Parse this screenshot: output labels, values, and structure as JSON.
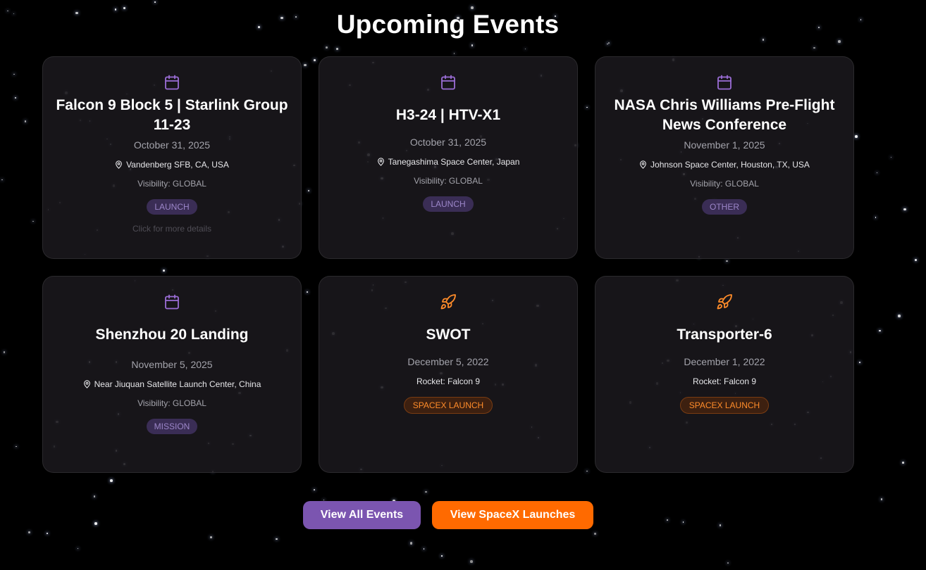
{
  "page": {
    "title": "Upcoming Events"
  },
  "events": [
    {
      "icon": "calendar-icon",
      "title": "Falcon 9 Block 5 | Starlink Group 11-23",
      "date": "October 31, 2025",
      "location": "Vandenberg SFB, CA, USA",
      "visibility": "Visibility: GLOBAL",
      "badge": "LAUNCH",
      "more": "Click for more details"
    },
    {
      "icon": "calendar-icon",
      "title": "H3-24 | HTV-X1",
      "date": "October 31, 2025",
      "location": "Tanegashima Space Center, Japan",
      "visibility": "Visibility: GLOBAL",
      "badge": "LAUNCH"
    },
    {
      "icon": "calendar-icon",
      "title": "NASA Chris Williams Pre-Flight News Conference",
      "date": "November 1, 2025",
      "location": "Johnson Space Center, Houston, TX, USA",
      "visibility": "Visibility: GLOBAL",
      "badge": "OTHER"
    },
    {
      "icon": "calendar-icon",
      "title": "Shenzhou 20 Landing",
      "date": "November 5, 2025",
      "location": "Near Jiuquan Satellite Launch Center, China",
      "visibility": "Visibility: GLOBAL",
      "badge": "MISSION"
    },
    {
      "icon": "rocket-icon",
      "title": "SWOT",
      "date": "December 5, 2022",
      "rocket": "Rocket: Falcon 9",
      "badge": "SPACEX LAUNCH"
    },
    {
      "icon": "rocket-icon",
      "title": "Transporter-6",
      "date": "December 1, 2022",
      "rocket": "Rocket: Falcon 9",
      "badge": "SPACEX LAUNCH"
    }
  ],
  "buttons": {
    "view_all": "View All Events",
    "view_spacex": "View SpaceX Launches"
  },
  "colors": {
    "background": "#000000",
    "accent_purple": "#7b55b0",
    "accent_orange": "#ff6a00",
    "calendar_icon": "#9b6dd6",
    "rocket_icon": "#ff8c2a"
  }
}
